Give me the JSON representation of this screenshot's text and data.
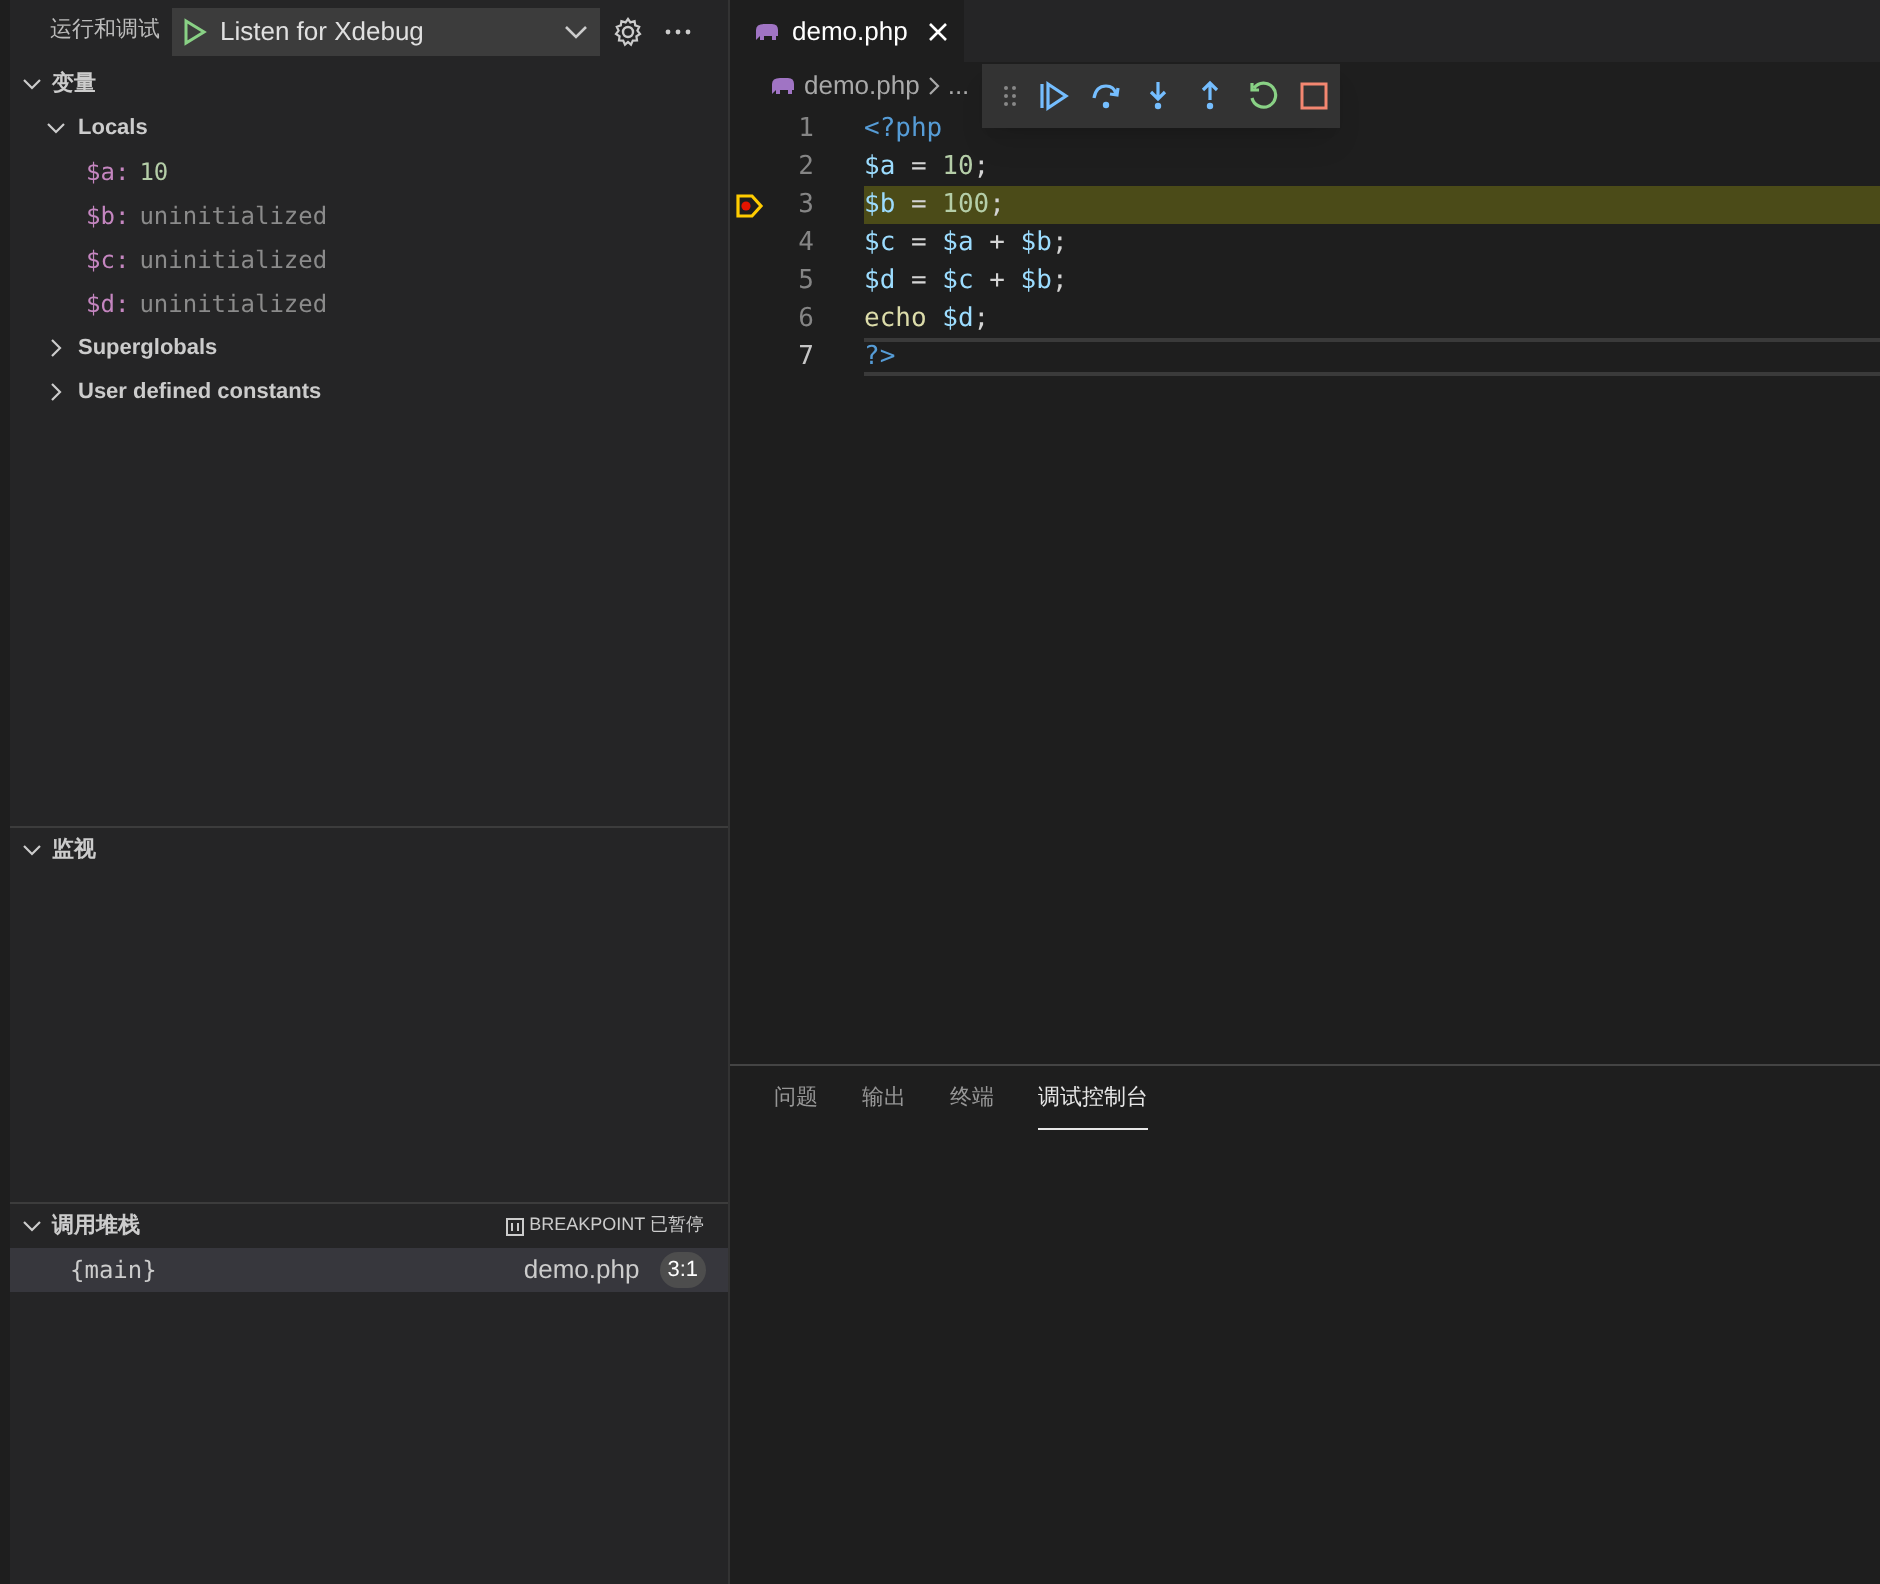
{
  "sidebar": {
    "title": "运行和调试",
    "config": "Listen for Xdebug",
    "variables": {
      "title": "变量",
      "expanded": true,
      "groups": [
        {
          "label": "Locals",
          "expanded": true,
          "items": [
            {
              "name": "$a:",
              "value": "10",
              "kind": "number"
            },
            {
              "name": "$b:",
              "value": "uninitialized",
              "kind": "uninitialized"
            },
            {
              "name": "$c:",
              "value": "uninitialized",
              "kind": "uninitialized"
            },
            {
              "name": "$d:",
              "value": "uninitialized",
              "kind": "uninitialized"
            }
          ]
        },
        {
          "label": "Superglobals",
          "expanded": false
        },
        {
          "label": "User defined constants",
          "expanded": false
        }
      ]
    },
    "watch": {
      "title": "监视",
      "expanded": true
    },
    "call_stack": {
      "title": "调用堆栈",
      "expanded": true,
      "status": "BREAKPOINT 已暂停",
      "frames": [
        {
          "name": "{main}",
          "file": "demo.php",
          "position": "3:1",
          "selected": true
        }
      ]
    }
  },
  "editor": {
    "tab": "demo.php",
    "breadcrumb": [
      "demo.php",
      "..."
    ],
    "lines": [
      {
        "number": "1",
        "current": false,
        "breakpoint": false,
        "cursor": false,
        "tokens": [
          {
            "text": "<?php",
            "kind": "tag"
          }
        ]
      },
      {
        "number": "2",
        "current": false,
        "breakpoint": false,
        "cursor": false,
        "tokens": [
          {
            "text": "$a",
            "kind": "var"
          },
          {
            "text": " = ",
            "kind": "op"
          },
          {
            "text": "10",
            "kind": "num"
          },
          {
            "text": ";",
            "kind": "op"
          }
        ]
      },
      {
        "number": "3",
        "current": true,
        "breakpoint": true,
        "cursor": false,
        "tokens": [
          {
            "text": "$b",
            "kind": "var"
          },
          {
            "text": " = ",
            "kind": "op"
          },
          {
            "text": "100",
            "kind": "num"
          },
          {
            "text": ";",
            "kind": "op"
          }
        ]
      },
      {
        "number": "4",
        "current": false,
        "breakpoint": false,
        "cursor": false,
        "tokens": [
          {
            "text": "$c",
            "kind": "var"
          },
          {
            "text": " = ",
            "kind": "op"
          },
          {
            "text": "$a",
            "kind": "var"
          },
          {
            "text": " + ",
            "kind": "op"
          },
          {
            "text": "$b",
            "kind": "var"
          },
          {
            "text": ";",
            "kind": "op"
          }
        ]
      },
      {
        "number": "5",
        "current": false,
        "breakpoint": false,
        "cursor": false,
        "tokens": [
          {
            "text": "$d",
            "kind": "var"
          },
          {
            "text": " = ",
            "kind": "op"
          },
          {
            "text": "$c",
            "kind": "var"
          },
          {
            "text": " + ",
            "kind": "op"
          },
          {
            "text": "$b",
            "kind": "var"
          },
          {
            "text": ";",
            "kind": "op"
          }
        ]
      },
      {
        "number": "6",
        "current": false,
        "breakpoint": false,
        "cursor": false,
        "tokens": [
          {
            "text": "echo",
            "kind": "kw"
          },
          {
            "text": " $d",
            "kind": "var"
          },
          {
            "text": ";",
            "kind": "op"
          }
        ]
      },
      {
        "number": "7",
        "current": false,
        "breakpoint": false,
        "cursor": true,
        "tokens": [
          {
            "text": "?>",
            "kind": "tag"
          }
        ]
      }
    ]
  },
  "panel": {
    "tabs": [
      {
        "label": "问题",
        "selected": false
      },
      {
        "label": "输出",
        "selected": false
      },
      {
        "label": "终端",
        "selected": false
      },
      {
        "label": "调试控制台",
        "selected": true
      }
    ]
  }
}
